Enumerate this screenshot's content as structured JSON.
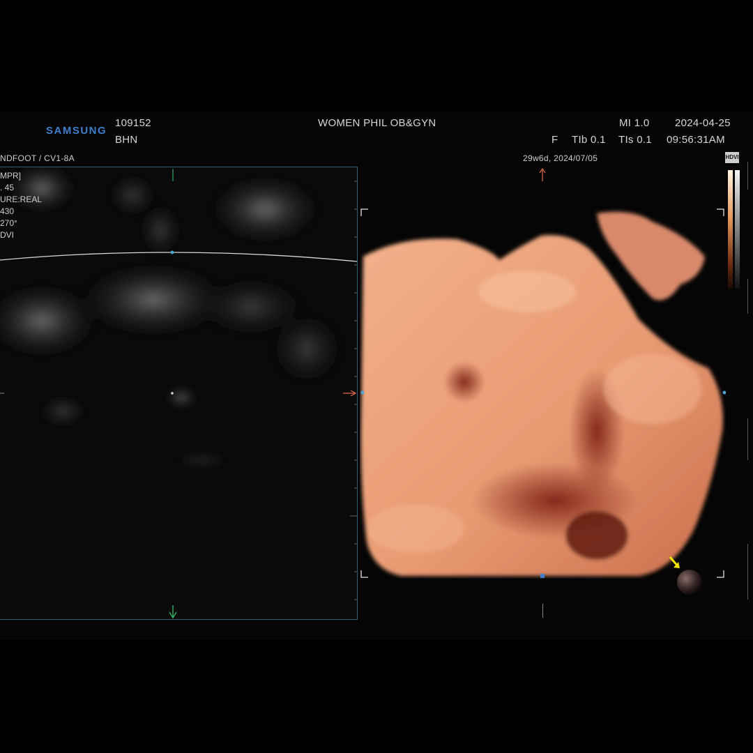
{
  "header": {
    "brand": "SAMSUNG",
    "patient_id": "109152",
    "patient_name": "BHN",
    "institution": "WOMEN PHIL OB&GYN",
    "mi": "MI 1.0",
    "date": "2024-04-25",
    "focus": "F",
    "tib": "TIb 0.1",
    "tis": "TIs 0.1",
    "time": "09:56:31AM",
    "preset": "NDFOOT / CV1-8A"
  },
  "left_panel": {
    "info_lines": [
      "MPR]",
      ". 45",
      "URE:REAL",
      "430",
      "270°",
      "DVI"
    ]
  },
  "right_panel": {
    "gestation": "29w6d, 2024/07/05",
    "badge": "HDVI"
  },
  "colors": {
    "logo": "#3f7fd0",
    "border": "#2f5e78",
    "skin": "#e8a079",
    "marker_arrow": "#f2e600"
  },
  "icons": [
    "light-source-ball-icon",
    "yellow-arrow-icon",
    "orientation-arrow-icon"
  ]
}
